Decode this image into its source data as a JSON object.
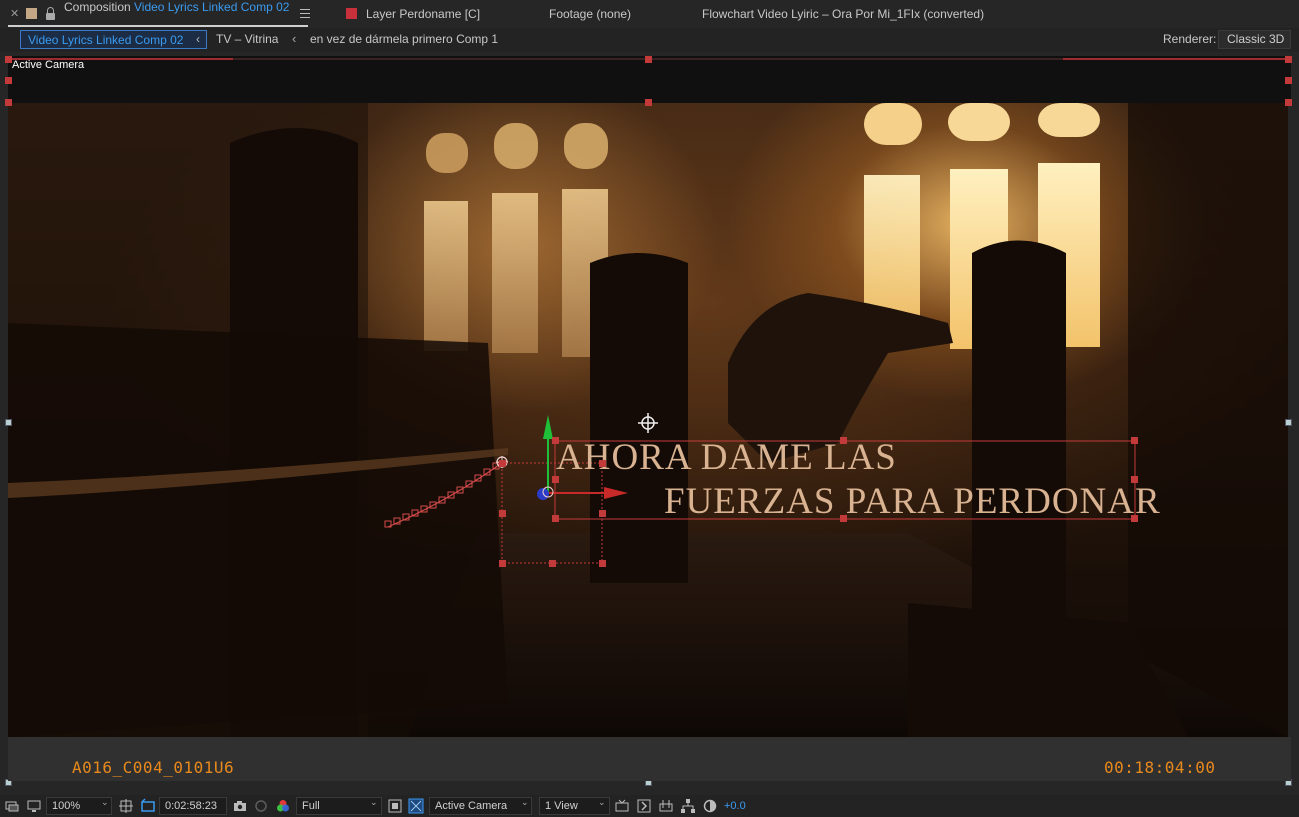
{
  "tabs": {
    "composition": {
      "label": "Composition",
      "name": "Video Lyrics Linked Comp 02"
    },
    "layer": {
      "label": "Layer Perdoname [C]"
    },
    "footage": {
      "label": "Footage (none)"
    },
    "flowchart": {
      "label": "Flowchart Video Lyiric – Ora Por Mi_1FIx (converted)"
    }
  },
  "breadcrumbs": {
    "active": "Video Lyrics Linked Comp 02",
    "items": [
      "TV – Vitrina",
      "en vez  de  dármela  primero Comp 1"
    ]
  },
  "renderer": {
    "label": "Renderer:",
    "value": "Classic 3D"
  },
  "viewer": {
    "camera_label": "Active Camera",
    "lyrics": {
      "line1": "AHORA DAME LAS",
      "line2": "FUERZAS PARA PERDONAR"
    },
    "timecode_left": "A016_C004_0101U6",
    "timecode_right": "00:18:04:00"
  },
  "toolbar": {
    "zoom": "100%",
    "timecode": "0:02:58:23",
    "resolution": "Full",
    "view": "Active Camera",
    "layout": "1 View",
    "exposure": "+0.0"
  },
  "colors": {
    "accent": "#3b9bf0",
    "layer_label": "#c8303c",
    "timecode": "#e8891c",
    "selection": "#c33a3a"
  },
  "icons": [
    "close-icon",
    "lock-icon",
    "panel-menu-icon",
    "camera-icon",
    "snapshot-icon",
    "color-channels-icon",
    "region-of-interest-icon",
    "transparency-grid-icon",
    "fast-preview-icon",
    "flowchart-icon",
    "reset-exposure-icon"
  ]
}
